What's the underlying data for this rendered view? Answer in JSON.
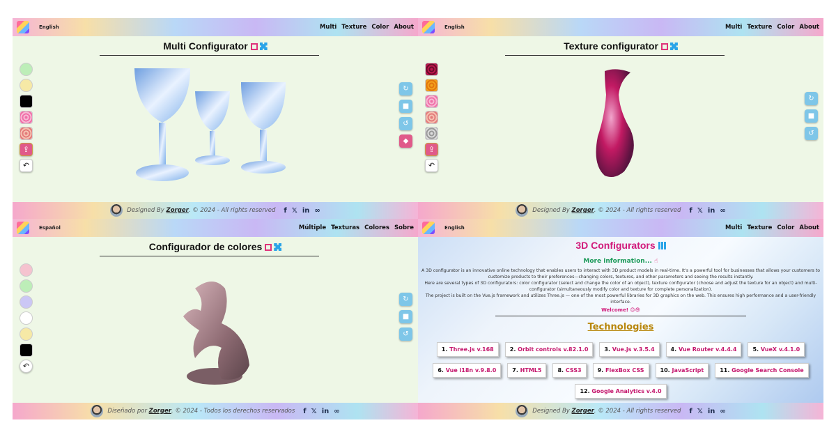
{
  "panels": {
    "multi": {
      "lang": "English",
      "nav": [
        "Multi",
        "Texture",
        "Color",
        "About"
      ],
      "title": "Multi Configurator",
      "footer": {
        "designed": "Designed By",
        "author": "Zorger",
        "rest": ". © 2024 - All rights reserved"
      }
    },
    "texture": {
      "lang": "English",
      "nav": [
        "Multi",
        "Texture",
        "Color",
        "About"
      ],
      "title": "Texture configurator",
      "footer": {
        "designed": "Designed By",
        "author": "Zorger",
        "rest": ". © 2024 - All rights reserved"
      }
    },
    "color": {
      "lang": "Español",
      "nav": [
        "Múltiple",
        "Texturas",
        "Colores",
        "Sobre"
      ],
      "title": "Configurador de colores",
      "footer": {
        "designed": "Diseñado por",
        "author": "Zorger",
        "rest": ". © 2024 - Todos los derechos reservados"
      }
    },
    "about": {
      "lang": "English",
      "nav": [
        "Multi",
        "Texture",
        "Color",
        "About"
      ],
      "title": "3D Configurators",
      "more": "More information...",
      "desc1": "A 3D configurator is an innovative online technology that enables users to interact with 3D product models in real-time. It's a powerful tool for businesses that allows your customers to customize products to their preferences—changing colors, textures, and other parameters and seeing the results instantly.",
      "desc2": "Here are several types of 3D configurators: color configurator (select and change the color of an object), texture configurator (choose and adjust the texture for an object) and multi-configurator (simultaneously modify color and texture for complete personalization).",
      "desc3": "The project is built on the Vue.js framework and utilizes Three.js — one of the most powerful libraries for 3D graphics on the web. This ensures high performance and a user-friendly interface.",
      "welcome": "Welcome! 😊😎",
      "tech_title": "Technologies",
      "technologies": [
        {
          "num": "1.",
          "name": "Three.js",
          "ver": "v.168"
        },
        {
          "num": "2.",
          "name": "Orbit controls",
          "ver": "v.82.1.0"
        },
        {
          "num": "3.",
          "name": "Vue.js",
          "ver": "v.3.5.4"
        },
        {
          "num": "4.",
          "name": "Vue Router",
          "ver": "v.4.4.4"
        },
        {
          "num": "5.",
          "name": "VueX",
          "ver": "v.4.1.0"
        },
        {
          "num": "6.",
          "name": "Vue i18n",
          "ver": "v.9.8.0"
        },
        {
          "num": "7.",
          "name": "HTML5",
          "ver": ""
        },
        {
          "num": "8.",
          "name": "CSS3",
          "ver": ""
        },
        {
          "num": "9.",
          "name": "FlexBox CSS",
          "ver": ""
        },
        {
          "num": "10.",
          "name": "JavaScript",
          "ver": ""
        },
        {
          "num": "11.",
          "name": "Google Search Console",
          "ver": ""
        },
        {
          "num": "12.",
          "name": "Google Analytics",
          "ver": "v.4.0"
        }
      ],
      "footer": {
        "designed": "Designed By",
        "author": "Zorger",
        "rest": ". © 2024 - All rights reserved"
      }
    }
  },
  "colors": {
    "accent": "#d11a7a",
    "swatch_blue": "#7ec6e8",
    "swatch_pink": "#e05a8a"
  }
}
